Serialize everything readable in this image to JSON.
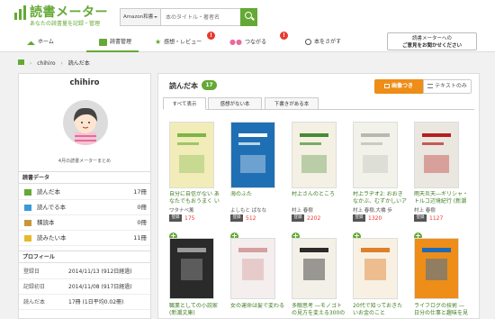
{
  "header": {
    "brand": "読書メーター",
    "tagline": "あなたの読書量を記録・管理",
    "search_category": "Amazon和書",
    "search_placeholder": "本のタイトル・著者名"
  },
  "nav": [
    {
      "label": "ホーム",
      "icon": "home-icon"
    },
    {
      "label": "読書管理",
      "icon": "book-icon"
    },
    {
      "label": "感想・レビュー",
      "icon": "star-icon",
      "badge": "!"
    },
    {
      "label": "つながる",
      "icon": "people-icon",
      "badge": "!"
    },
    {
      "label": "本をさがす",
      "icon": "search-icon"
    }
  ],
  "announcement": {
    "line1": "読書メーターへの",
    "line2": "ご意見をお聞かせください"
  },
  "breadcrumb": [
    "chihiro",
    "読んだ本"
  ],
  "profile": {
    "name": "chihiro",
    "avatar_caption": "4月の読書メーターまとめ",
    "reading_header": "読書データ",
    "reading": [
      {
        "label": "読んだ本",
        "count": "17冊",
        "icon": "read-icon",
        "color": "#64a935"
      },
      {
        "label": "読んでる本",
        "count": "0冊",
        "icon": "reading-icon",
        "color": "#3b9ad6"
      },
      {
        "label": "積読本",
        "count": "0冊",
        "icon": "stack-icon",
        "color": "#c9963b"
      },
      {
        "label": "読みたい本",
        "count": "11冊",
        "icon": "wish-icon",
        "color": "#e8b82b"
      }
    ],
    "profile_header": "プロフィール",
    "details": [
      {
        "key": "登録日",
        "value": "2014/11/13 (912日経過)"
      },
      {
        "key": "記録初日",
        "value": "2014/11/08 (917日経過)"
      },
      {
        "key": "読んだ本",
        "value": "17冊 (1日平均0.02冊)"
      }
    ]
  },
  "shelf": {
    "title": "読んだ本",
    "count": "17",
    "view_image": "画像つき",
    "view_text": "テキストのみ",
    "tabs": [
      "すべて表示",
      "感想がない本",
      "下書きがある本"
    ],
    "badge_label": "登録",
    "books": [
      {
        "title": "自分に自信がない あなたでもおうまく いく",
        "author": "ワタナベ薫",
        "pages": "175",
        "cover": "#f2ecb8",
        "accent": "#7ab648"
      },
      {
        "title": "海のふた",
        "author": "よしもと ばなな",
        "pages": "512",
        "cover": "#1f6fb5",
        "accent": "#ffffff"
      },
      {
        "title": "村上さんのところ",
        "author": "村上 春樹",
        "pages": "2202",
        "cover": "#f4f1e4",
        "accent": "#4a8a33"
      },
      {
        "title": "村上ラヂオ2: おおきなかぶ、むずかしいアボ",
        "author": "村上 春樹,大橋 歩",
        "pages": "1320",
        "cover": "#f2f2ea",
        "accent": "#b8b9ae"
      },
      {
        "title": "雨天炎天―ギリシャ・トルコ辺境紀行 (新潮",
        "author": "村上 春樹",
        "pages": "1127",
        "cover": "#e9e7df",
        "accent": "#b61e1e"
      },
      {
        "title": "職業としての小説家 (新潮文庫)",
        "author": "",
        "pages": "",
        "cover": "#2a2a2a",
        "accent": "#9a9a9a"
      },
      {
        "title": "女の運命は髪で変わる",
        "author": "",
        "pages": "",
        "cover": "#f4eeee",
        "accent": "#d6a0a0"
      },
      {
        "title": "多眼思考 ―モノゴトの見方を変える300の",
        "author": "",
        "pages": "",
        "cover": "#f3f0e8",
        "accent": "#2b2b2b"
      },
      {
        "title": "20代で知っておきたいお金のこと",
        "author": "",
        "pages": "",
        "cover": "#f8f1e3",
        "accent": "#e07f2a"
      },
      {
        "title": "ライフログの技術 ―日分の仕事と趣味を見",
        "author": "",
        "pages": "",
        "cover": "#ee8d17",
        "accent": "#1e6bb8"
      }
    ]
  }
}
